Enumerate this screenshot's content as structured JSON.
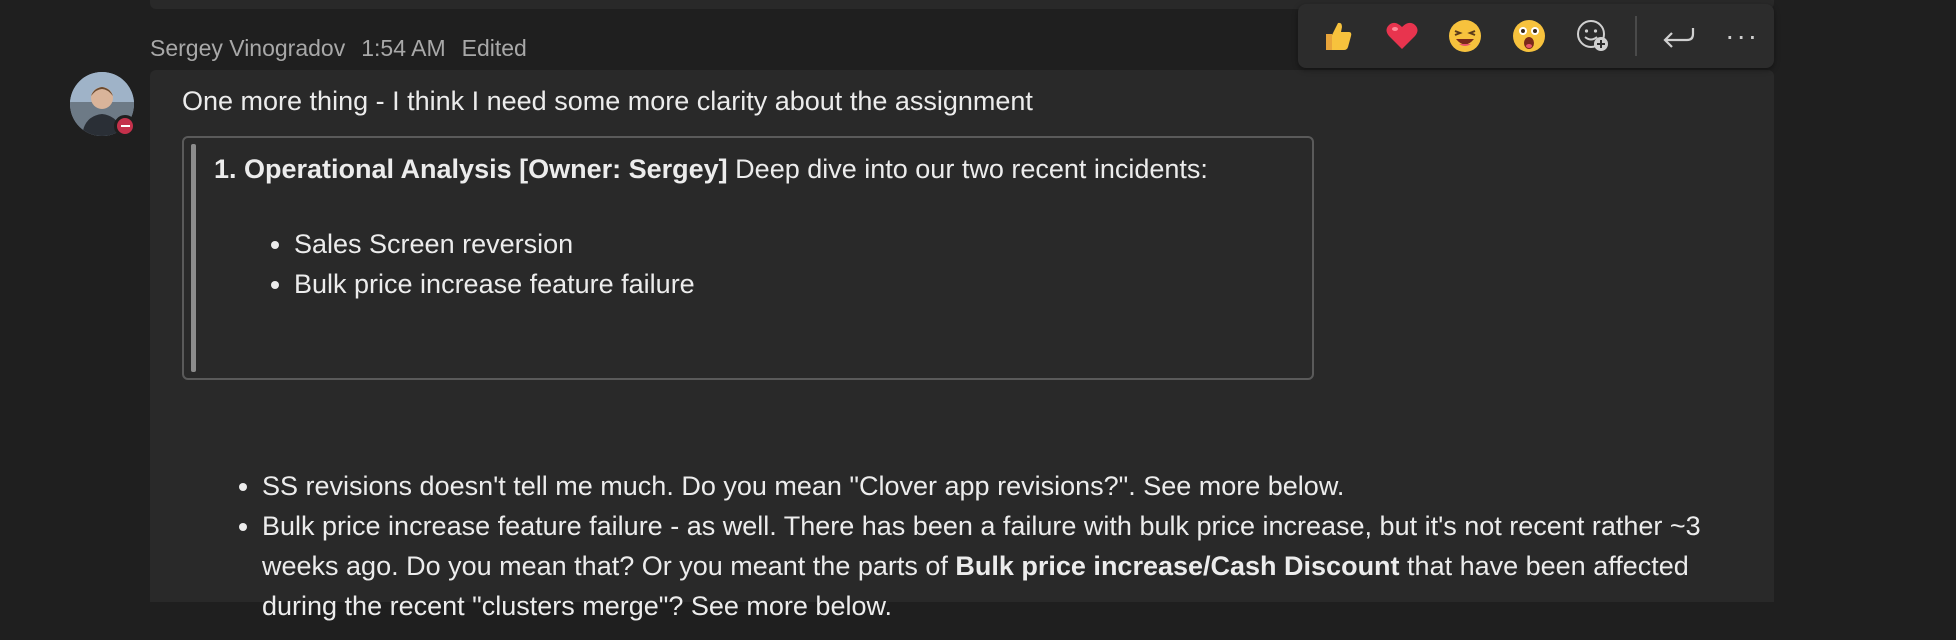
{
  "message": {
    "author": "Sergey Vinogradov",
    "time": "1:54 AM",
    "edited": "Edited",
    "first_line": "One more thing - I think I need some more clarity about the assignment",
    "quote": {
      "title_bold": "1. Operational Analysis [Owner: Sergey]",
      "title_rest": " Deep dive into our two recent incidents:",
      "items": [
        "Sales Screen reversion",
        "Bulk price increase feature failure"
      ]
    },
    "bullets": {
      "b1": "SS revisions doesn't tell me much. Do you mean \"Clover app revisions?\". See more below.",
      "b2_part1": "Bulk price increase feature failure - as well. There has been a failure with bulk price increase, but it's not recent rather ~3 weeks ago. Do you mean that? Or you meant the parts of ",
      "b2_bold": "Bulk price increase/Cash Discount",
      "b2_part2": " that have been affected during the recent \"clusters merge\"? See more below."
    }
  },
  "avatar_status": "do-not-disturb",
  "reactions": [
    "thumbs-up",
    "heart",
    "laughing",
    "surprised",
    "add-reaction"
  ],
  "actions": [
    "reply",
    "more-options"
  ],
  "colors": {
    "status": "#c4314b",
    "heart": "#e8344e",
    "emoji": "#f7c23d"
  }
}
